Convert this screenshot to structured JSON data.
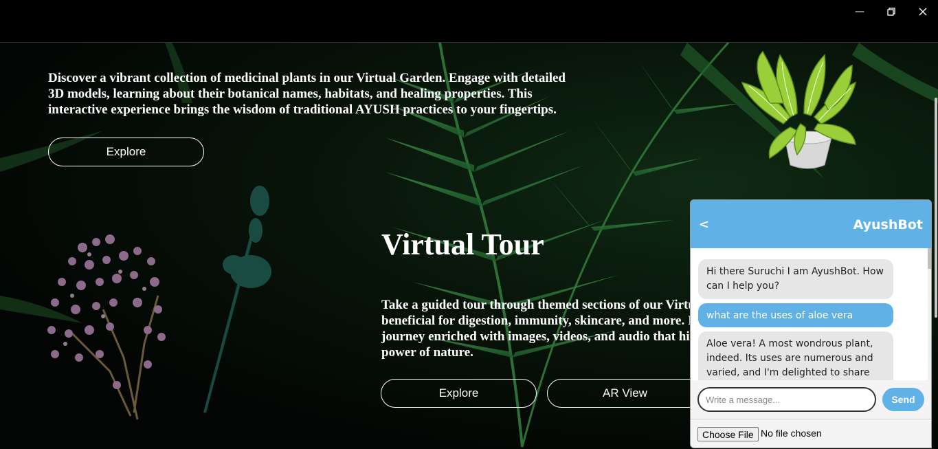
{
  "window": {
    "minimize_icon": "minimize-icon",
    "maximize_icon": "restore-icon",
    "close_icon": "close-icon"
  },
  "hero": {
    "intro": "Discover a vibrant collection of medicinal plants in our Virtual Garden. Engage with detailed 3D models, learning about their botanical names, habitats, and healing properties. This interactive experience brings the wisdom of traditional AYUSH practices to your fingertips.",
    "explore_label": "Explore"
  },
  "tour": {
    "title": "Virtual Tour",
    "lines": [
      "Take a guided tour through themed sections of our Virtu",
      "beneficial for digestion, immunity, skincare, and more. I",
      "journey enriched with images, videos, and audio that hig",
      "power of nature."
    ],
    "explore_label": "Explore",
    "ar_label": "AR View"
  },
  "chat": {
    "back_label": "<",
    "title": "AyushBot",
    "messages": [
      {
        "role": "bot",
        "text": "Hi there Suruchi I am AyushBot. How can I help you?"
      },
      {
        "role": "user",
        "text": "what are the uses of aloe vera"
      },
      {
        "role": "bot",
        "text": "Aloe vera! A most wondrous plant, indeed. Its uses are numerous and varied, and I'm delighted to share"
      }
    ],
    "input_placeholder": "Write a message...",
    "send_label": "Send",
    "file_button_label": "Choose File",
    "file_status": "No file chosen"
  },
  "colors": {
    "accent": "#5fb1e6",
    "bot_bubble": "#e6e6e6",
    "background": "#000000"
  }
}
